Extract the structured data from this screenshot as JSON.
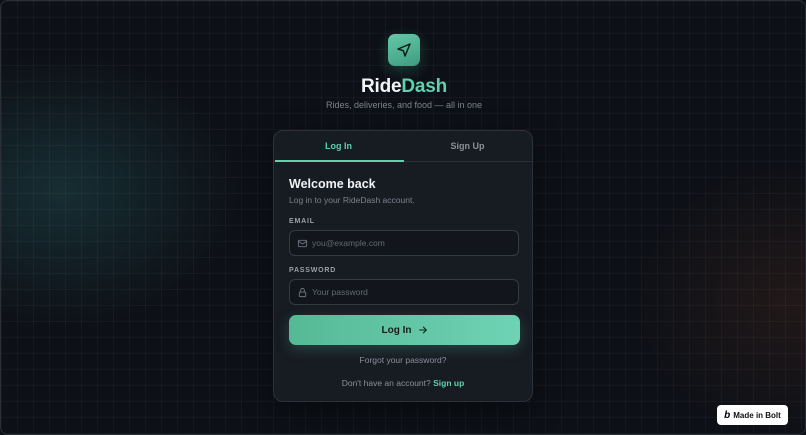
{
  "brand": {
    "name_part1": "Ride",
    "name_part2": "Dash",
    "tagline": "Rides, deliveries, and food — all in one",
    "logo_icon": "navigation-arrow-icon",
    "accent_color": "#5fd1ad"
  },
  "tabs": [
    {
      "label": "Log In",
      "active": true
    },
    {
      "label": "Sign Up",
      "active": false
    }
  ],
  "form": {
    "title": "Welcome back",
    "subtitle": "Log in to your RideDash account.",
    "email": {
      "label": "EMAIL",
      "placeholder": "you@example.com",
      "value": "",
      "icon": "mail-icon"
    },
    "password": {
      "label": "PASSWORD",
      "placeholder": "Your password",
      "value": "",
      "icon": "lock-icon"
    },
    "submit_label": "Log In",
    "forgot_label": "Forgot your password?",
    "signup_prompt": "Don't have an account?",
    "signup_link": "Sign up"
  },
  "badge": {
    "mark": "b",
    "label": "Made in Bolt"
  }
}
